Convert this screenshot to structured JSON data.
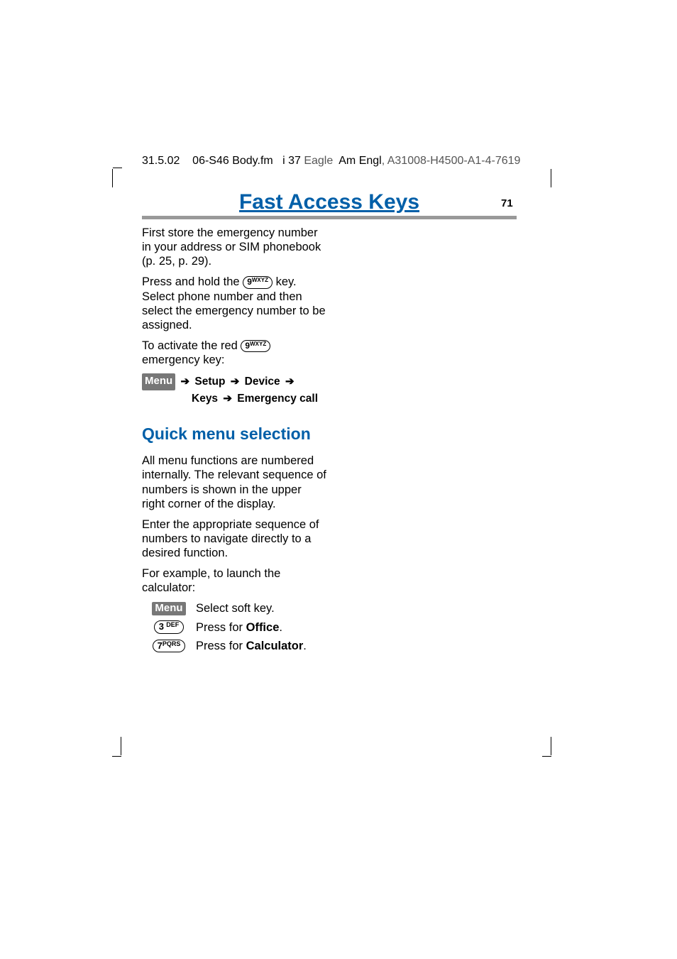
{
  "header": {
    "date": "31.5.02",
    "filename": "06-S46 Body.fm",
    "index": "i 37",
    "project": "Eagle",
    "lang": "Am Engl",
    "doc_id": ", A31008-H4500-A1-4-7619"
  },
  "page_title": "Fast Access Keys",
  "page_number": "71",
  "body": {
    "p1": "First store the emergency number in your address or SIM phonebook (p. 25, p. 29).",
    "p2a": "Press and hold the ",
    "p2b": " key. Select phone number and then select the emergency number to be assigned.",
    "p3a": "To activate the red ",
    "p3b": " emergency key:",
    "key9_digit": "9",
    "key9_label": "WXYZ"
  },
  "nav": {
    "menu": "Menu",
    "setup": "Setup",
    "device": "Device",
    "keys": "Keys",
    "emergency": "Emergency call"
  },
  "section2": {
    "title": "Quick menu selection",
    "p1": "All menu functions are numbered internally. The relevant sequence of numbers is shown in the upper right corner of the display.",
    "p2": "Enter the appropriate sequence of numbers to navigate directly to a desired function.",
    "p3": "For example, to launch the calculator:"
  },
  "steps": {
    "menu_label": "Menu",
    "menu_text": "Select soft key.",
    "k3_digit": "3",
    "k3_lbl": "DEF",
    "k3_text_a": "Press for ",
    "k3_text_b": "Office",
    "k7_digit": "7",
    "k7_lbl": "PQRS",
    "k7_text_a": "Press for ",
    "k7_text_b": "Calculator",
    "period": "."
  }
}
